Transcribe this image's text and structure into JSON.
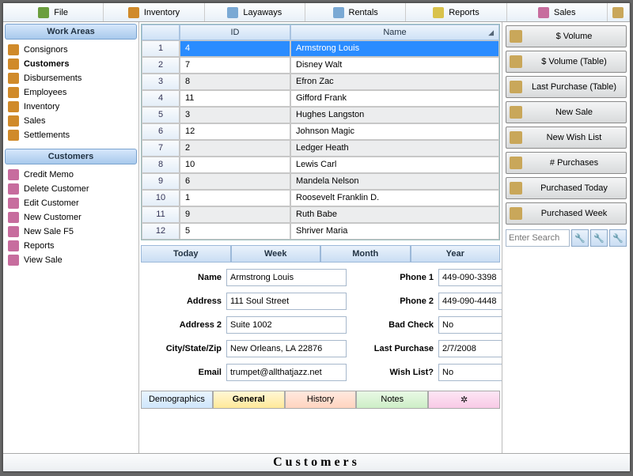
{
  "menu": {
    "items": [
      "File",
      "Inventory",
      "Layaways",
      "Rentals",
      "Reports",
      "Sales"
    ]
  },
  "work_areas": {
    "title": "Work Areas",
    "items": [
      {
        "label": "Consignors",
        "sel": false
      },
      {
        "label": "Customers",
        "sel": true
      },
      {
        "label": "Disbursements",
        "sel": false
      },
      {
        "label": "Employees",
        "sel": false
      },
      {
        "label": "Inventory",
        "sel": false
      },
      {
        "label": "Sales",
        "sel": false
      },
      {
        "label": "Settlements",
        "sel": false
      }
    ]
  },
  "customers_panel": {
    "title": "Customers",
    "items": [
      "Credit Memo",
      "Delete Customer",
      "Edit Customer",
      "New Customer",
      "New Sale  F5",
      "Reports",
      "View Sale"
    ]
  },
  "grid": {
    "headers": {
      "id": "ID",
      "name": "Name"
    },
    "rows": [
      {
        "n": "1",
        "id": "4",
        "name": "Armstrong Louis",
        "sel": true
      },
      {
        "n": "2",
        "id": "7",
        "name": "Disney Walt"
      },
      {
        "n": "3",
        "id": "8",
        "name": "Efron Zac"
      },
      {
        "n": "4",
        "id": "11",
        "name": "Gifford Frank"
      },
      {
        "n": "5",
        "id": "3",
        "name": "Hughes Langston"
      },
      {
        "n": "6",
        "id": "12",
        "name": "Johnson Magic"
      },
      {
        "n": "7",
        "id": "2",
        "name": "Ledger Heath"
      },
      {
        "n": "8",
        "id": "10",
        "name": "Lewis Carl"
      },
      {
        "n": "9",
        "id": "6",
        "name": "Mandela Nelson"
      },
      {
        "n": "10",
        "id": "1",
        "name": "Roosevelt Franklin D."
      },
      {
        "n": "11",
        "id": "9",
        "name": "Ruth Babe"
      },
      {
        "n": "12",
        "id": "5",
        "name": "Shriver Maria"
      }
    ]
  },
  "right_buttons": [
    "$ Volume",
    "$ Volume (Table)",
    "Last Purchase (Table)",
    "New Sale",
    "New Wish List",
    "# Purchases",
    "Purchased Today",
    "Purchased Week"
  ],
  "search_placeholder": "Enter Search",
  "time_tabs": [
    "Today",
    "Week",
    "Month",
    "Year"
  ],
  "detail": {
    "left": {
      "Name": "Armstrong Louis",
      "Address": "111 Soul Street",
      "Address 2": "Suite 1002",
      "City/State/Zip": "New Orleans, LA 22876",
      "Email": "trumpet@allthatjazz.net"
    },
    "right": {
      "Phone 1": "449-090-3398",
      "Phone 2": "449-090-4448",
      "Bad Check": "No",
      "Last Purchase": "2/7/2008",
      "Wish List?": "No"
    }
  },
  "detail_labels": {
    "name": "Name",
    "address": "Address",
    "address2": "Address 2",
    "csz": "City/State/Zip",
    "email": "Email",
    "phone1": "Phone 1",
    "phone2": "Phone 2",
    "badcheck": "Bad Check",
    "lastpurchase": "Last Purchase",
    "wishlist": "Wish List?"
  },
  "bottom_tabs": {
    "demo": "Demographics",
    "general": "General",
    "history": "History",
    "notes": "Notes"
  },
  "footer": "Customers",
  "icon_colors": {
    "menu": "#6b9e3e",
    "nav": "#d08a2a",
    "right": "#c9a75a"
  }
}
